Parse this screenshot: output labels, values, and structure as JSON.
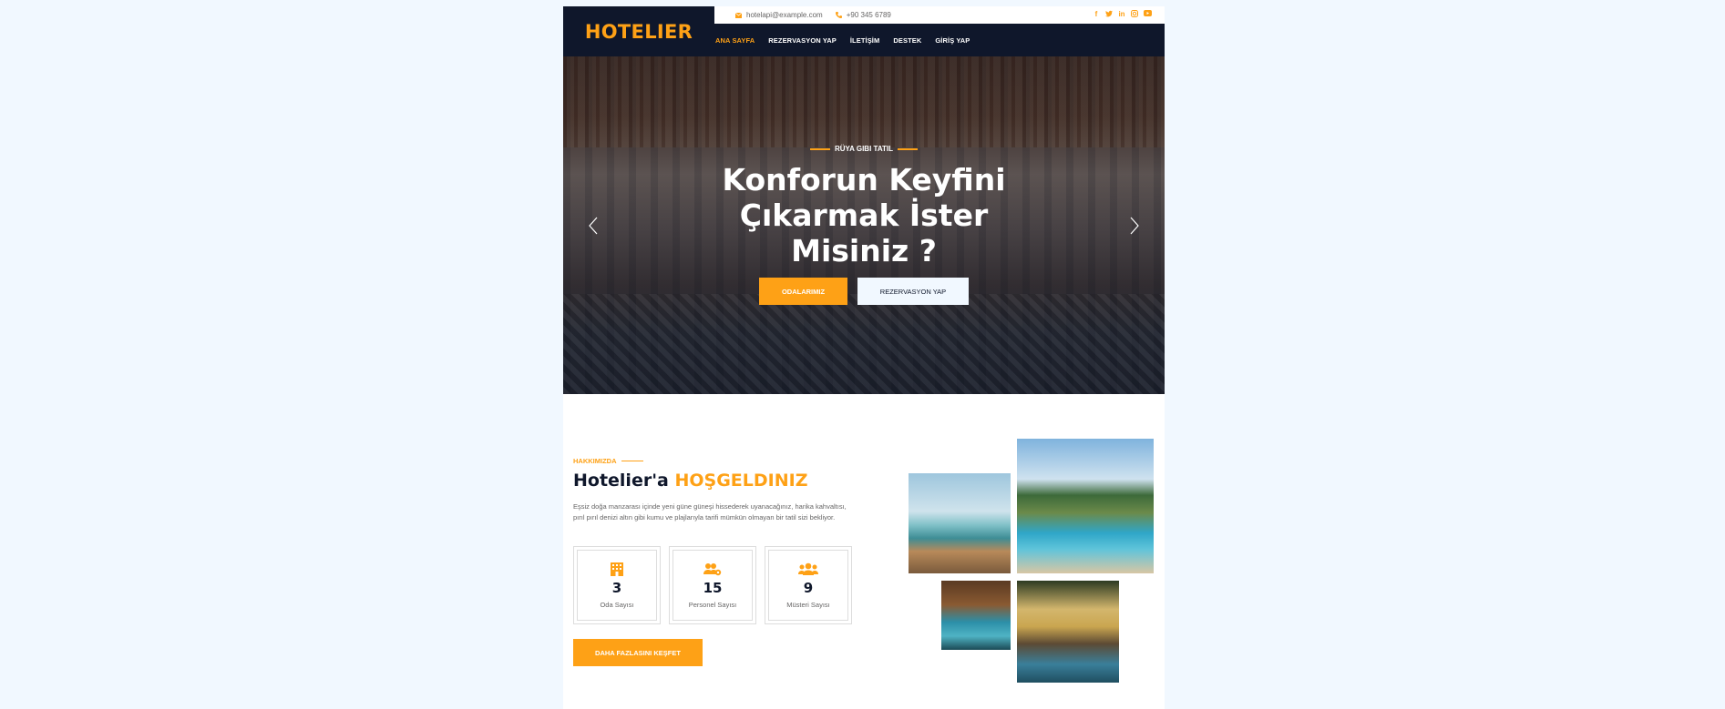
{
  "brand": {
    "name": "HOTELIER"
  },
  "topbar": {
    "email": "hotelapi@example.com",
    "phone": "+90 345 6789",
    "social": [
      "facebook-icon",
      "twitter-icon",
      "linkedin-icon",
      "instagram-icon",
      "youtube-icon"
    ]
  },
  "nav": {
    "items": [
      {
        "label": "ANA SAYFA"
      },
      {
        "label": "REZERVASYON YAP"
      },
      {
        "label": "İLETİŞİM"
      },
      {
        "label": "DESTEK"
      },
      {
        "label": "GİRİŞ YAP"
      }
    ]
  },
  "hero": {
    "kicker": "RÜYA GIBI TATIL",
    "title": "Konforun Keyfini Çıkarmak İster Misiniz ?",
    "primary_button": "ODALARIMIZ",
    "secondary_button": "REZERVASYON YAP"
  },
  "about": {
    "kicker": "HAKKIMIZDA",
    "title_prefix": "Hotelier'a",
    "title_highlight": "HOŞGELDINIZ",
    "text": "Eşsiz doğa manzarası içinde yeni güne güneşi hissederek uyanacağınız, harika kahvaltısı, pırıl pırıl denizi altın gibi kumu ve plajlarıyla tarifi mümkün olmayan bir tatil sizi bekliyor.",
    "stats": [
      {
        "icon": "hotel-icon",
        "value": "3",
        "label": "Oda Sayısı"
      },
      {
        "icon": "users-cog-icon",
        "value": "15",
        "label": "Personel Sayısı"
      },
      {
        "icon": "users-icon",
        "value": "9",
        "label": "Müsteri Sayısı"
      }
    ],
    "more_button": "DAHA FAZLASINI KEŞFET"
  },
  "colors": {
    "accent": "#FEA116",
    "dark": "#0F172B",
    "background": "#F1F8FF"
  }
}
